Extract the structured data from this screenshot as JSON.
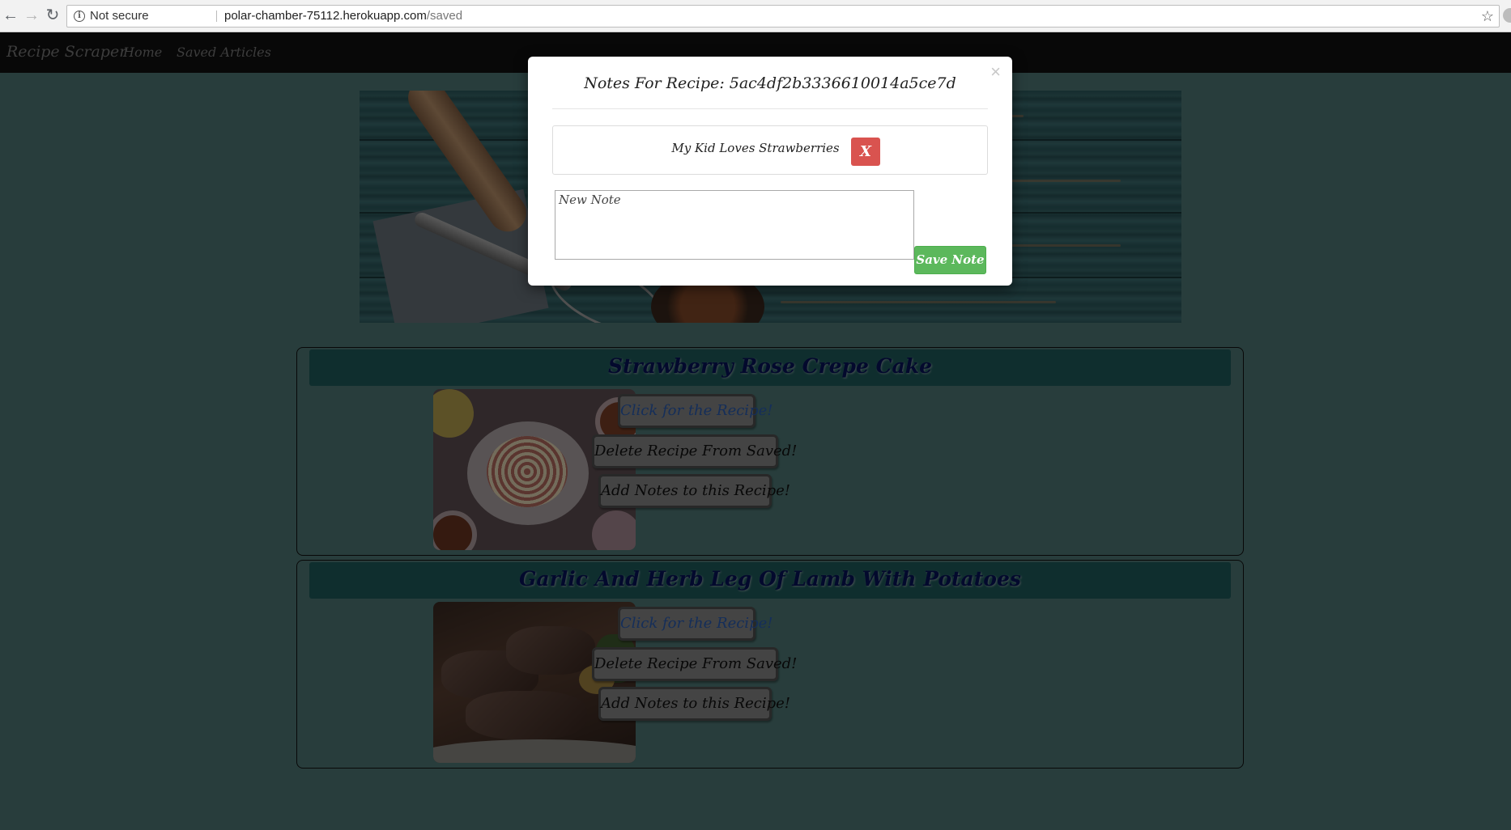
{
  "browser": {
    "security_label": "Not secure",
    "url_host": "polar-chamber-75112.herokuapp.com",
    "url_path": "/saved"
  },
  "navbar": {
    "brand": "Recipe Scraper",
    "items": [
      {
        "label": "Home"
      },
      {
        "label": "Saved Articles"
      }
    ]
  },
  "recipes": [
    {
      "title": "Strawberry Rose Crepe Cake",
      "recipe_button": "Click for the Recipe!",
      "delete_button": "Delete Recipe From Saved!",
      "notes_button": "Add Notes to this Recipe!"
    },
    {
      "title": "Garlic And Herb Leg Of Lamb With Potatoes",
      "recipe_button": "Click for the Recipe!",
      "delete_button": "Delete Recipe From Saved!",
      "notes_button": "Add Notes to this Recipe!"
    }
  ],
  "modal": {
    "title": "Notes For Recipe: 5ac4df2b3336610014a5ce7d",
    "close_glyph": "×",
    "notes": [
      {
        "text": "My Kid Loves Strawberries",
        "delete_label": "X"
      }
    ],
    "new_note_placeholder": "New Note",
    "save_label": "Save Note"
  },
  "colors": {
    "page_background": "#507b78",
    "title_bar": "#1e5c5d",
    "title_text": "#07135a",
    "save_button": "#5cb85c",
    "delete_note_button": "#d9534f"
  }
}
